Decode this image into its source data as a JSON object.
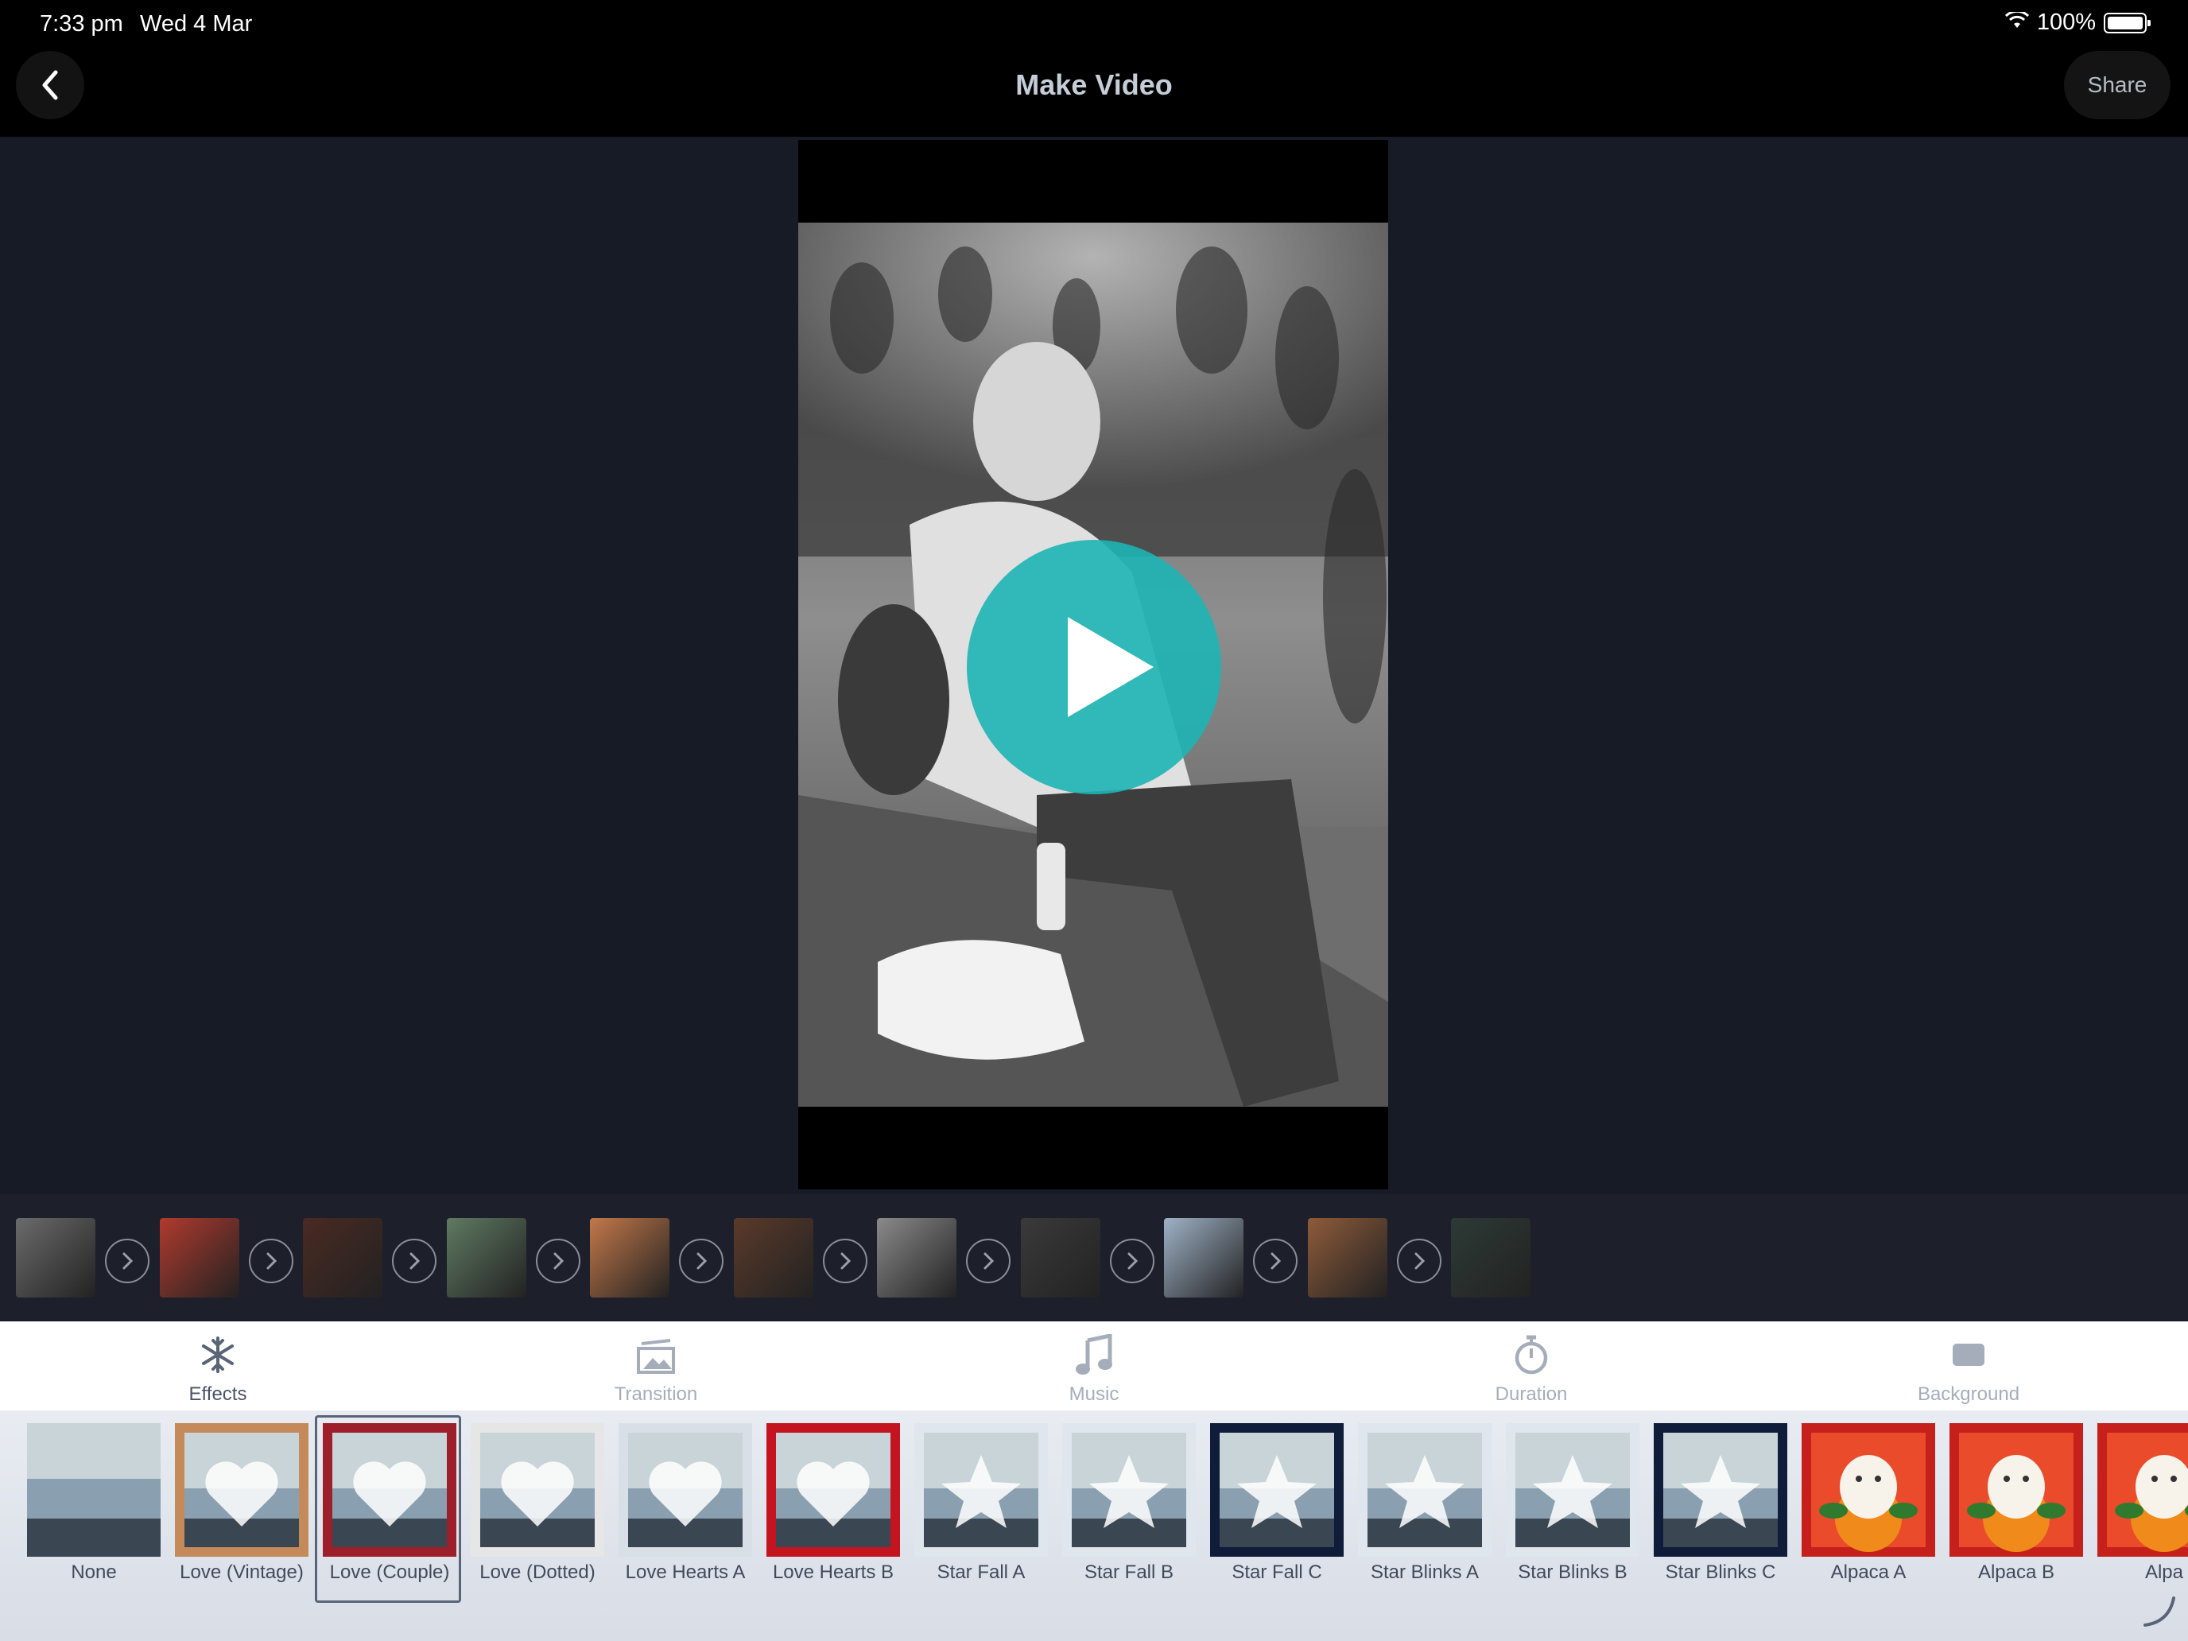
{
  "status": {
    "time": "7:33 pm",
    "date": "Wed 4 Mar",
    "battery": "100%"
  },
  "header": {
    "title": "Make Video",
    "share_label": "Share",
    "back_icon": "chevron-left-icon"
  },
  "preview": {
    "play_icon": "play-icon",
    "accent": "#1eb4b4"
  },
  "timeline": {
    "clips": [
      {
        "name": "clip-1",
        "tone": "#6b6b6b"
      },
      {
        "name": "clip-2",
        "tone": "#b03a2e"
      },
      {
        "name": "clip-3",
        "tone": "#4a2a22"
      },
      {
        "name": "clip-4",
        "tone": "#5f7a62"
      },
      {
        "name": "clip-5",
        "tone": "#c2784a"
      },
      {
        "name": "clip-6",
        "tone": "#5a3a2a"
      },
      {
        "name": "clip-7",
        "tone": "#8a8a8a"
      },
      {
        "name": "clip-8",
        "tone": "#3a3a3a"
      },
      {
        "name": "clip-9",
        "tone": "#9fb2c6"
      },
      {
        "name": "clip-10",
        "tone": "#8e5b3a"
      },
      {
        "name": "clip-11",
        "tone": "#2d3a36"
      }
    ],
    "transition_icon": "chevron-right-icon"
  },
  "tabs": [
    {
      "label": "Effects",
      "icon": "snowflake-icon",
      "active": true
    },
    {
      "label": "Transition",
      "icon": "photo-stack-icon",
      "active": false
    },
    {
      "label": "Music",
      "icon": "music-note-icon",
      "active": false
    },
    {
      "label": "Duration",
      "icon": "timer-icon",
      "active": false
    },
    {
      "label": "Background",
      "icon": "rectangle-icon",
      "active": false
    }
  ],
  "effects": [
    {
      "label": "None",
      "frame": "none"
    },
    {
      "label": "Love (Vintage)",
      "frame": "#c58a5a"
    },
    {
      "label": "Love (Couple)",
      "frame": "#9c1f2a",
      "selected": true
    },
    {
      "label": "Love (Dotted)",
      "frame": "#e6e6e6"
    },
    {
      "label": "Love Hearts A",
      "frame": "#d9dfe6"
    },
    {
      "label": "Love Hearts B",
      "frame": "#c4141f"
    },
    {
      "label": "Star Fall A",
      "frame": "#dfe6ee"
    },
    {
      "label": "Star Fall B",
      "frame": "#dfe6ee"
    },
    {
      "label": "Star Fall C",
      "frame": "#0f1c3a"
    },
    {
      "label": "Star Blinks A",
      "frame": "#dfe6ee"
    },
    {
      "label": "Star Blinks B",
      "frame": "#dfe6ee"
    },
    {
      "label": "Star Blinks C",
      "frame": "#0f1c3a"
    },
    {
      "label": "Alpaca A",
      "frame": "#c5201c"
    },
    {
      "label": "Alpaca B",
      "frame": "#c5201c"
    },
    {
      "label": "Alpa",
      "frame": "#c5201c"
    }
  ]
}
